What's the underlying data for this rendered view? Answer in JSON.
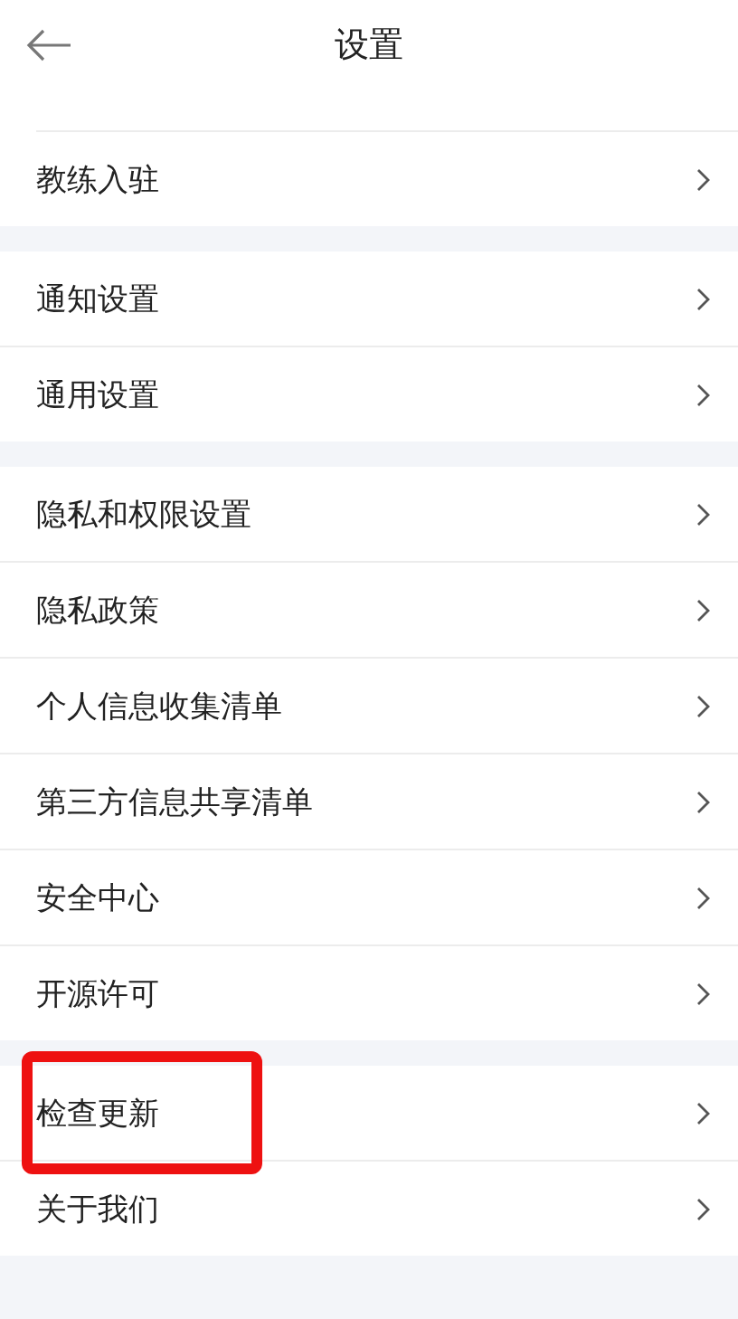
{
  "header": {
    "title": "设置"
  },
  "groups": [
    {
      "items": [
        {
          "label": "教练入驻",
          "highlighted": false
        }
      ]
    },
    {
      "items": [
        {
          "label": "通知设置",
          "highlighted": false
        },
        {
          "label": "通用设置",
          "highlighted": false
        }
      ]
    },
    {
      "items": [
        {
          "label": "隐私和权限设置",
          "highlighted": false
        },
        {
          "label": "隐私政策",
          "highlighted": false
        },
        {
          "label": "个人信息收集清单",
          "highlighted": false
        },
        {
          "label": "第三方信息共享清单",
          "highlighted": false
        },
        {
          "label": "安全中心",
          "highlighted": false
        },
        {
          "label": "开源许可",
          "highlighted": false
        }
      ]
    },
    {
      "items": [
        {
          "label": "检查更新",
          "highlighted": true
        },
        {
          "label": "关于我们",
          "highlighted": false
        }
      ]
    }
  ]
}
